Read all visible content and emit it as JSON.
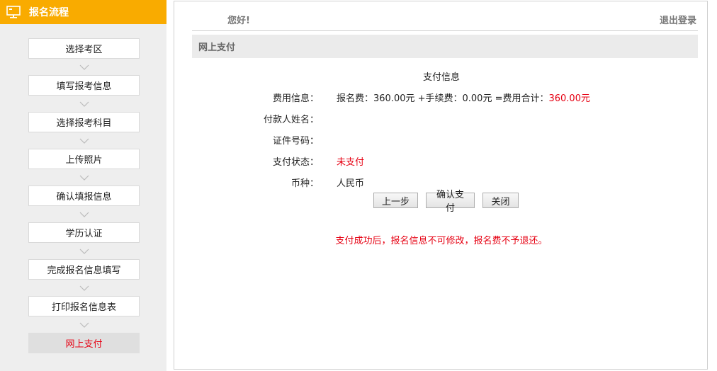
{
  "sidebar": {
    "title": "报名流程",
    "steps": [
      {
        "label": "选择考区"
      },
      {
        "label": "填写报考信息"
      },
      {
        "label": "选择报考科目"
      },
      {
        "label": "上传照片"
      },
      {
        "label": "确认填报信息"
      },
      {
        "label": "学历认证"
      },
      {
        "label": "完成报名信息填写"
      },
      {
        "label": "打印报名信息表"
      },
      {
        "label": "网上支付"
      }
    ],
    "active_step": "网上支付"
  },
  "header": {
    "greeting": "您好!",
    "logout": "退出登录"
  },
  "section": {
    "title": "网上支付"
  },
  "payment": {
    "title": "支付信息",
    "fee_label": "费用信息：",
    "fee_value_prefix": "报名费：360.00元 +手续费：0.00元 =费用合计：",
    "fee_total": "360.00元",
    "payer_label": "付款人姓名：",
    "payer_value": "",
    "id_label": "证件号码：",
    "id_value": "",
    "status_label": "支付状态：",
    "status_value": "未支付",
    "currency_label": "币种：",
    "currency_value": "人民币"
  },
  "buttons": {
    "prev": "上一步",
    "confirm": "确认支付",
    "close": "关闭"
  },
  "notice": "支付成功后，报名信息不可修改，报名费不予退还。",
  "colors": {
    "accent": "#f9ab00",
    "alert": "#e60012",
    "sidebar_bg": "#eeeeee"
  }
}
